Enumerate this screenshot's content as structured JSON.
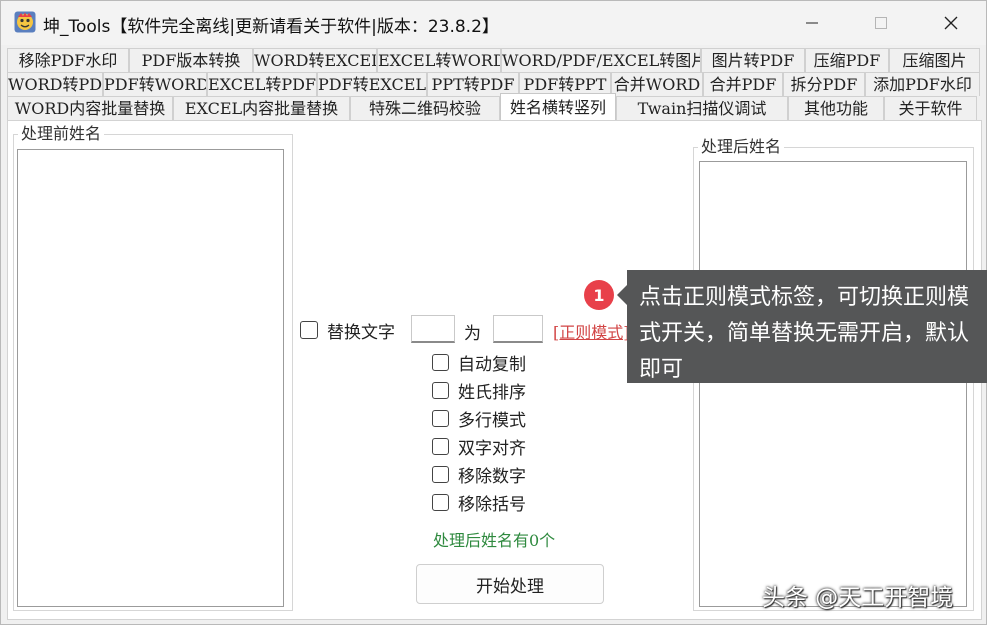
{
  "window": {
    "title": "坤_Tools【软件完全离线|更新请看关于软件|版本：23.8.2】",
    "icon": "app-logo-icon"
  },
  "tab_rows": [
    [
      "移除PDF水印",
      "PDF版本转换",
      "WORD转EXCEL",
      "EXCEL转WORD",
      "WORD/PDF/EXCEL转图片",
      "图片转PDF",
      "压缩PDF",
      "压缩图片"
    ],
    [
      "WORD转PDF",
      "PDF转WORD",
      "EXCEL转PDF",
      "PDF转EXCEL",
      "PPT转PDF",
      "PDF转PPT",
      "合并WORD",
      "合并PDF",
      "拆分PDF",
      "添加PDF水印"
    ],
    [
      "WORD内容批量替换",
      "EXCEL内容批量替换",
      "特殊二维码校验",
      "姓名横转竖列",
      "Twain扫描仪调试",
      "其他功能",
      "关于软件"
    ]
  ],
  "active_tab": "姓名横转竖列",
  "left_group": {
    "label": "处理前姓名"
  },
  "right_group": {
    "label": "处理后姓名"
  },
  "replace": {
    "label": "替换文字",
    "to_label": "为",
    "from_value": "",
    "to_value": "",
    "regex_link": "[正则模式]"
  },
  "options": [
    "自动复制",
    "姓氏排序",
    "多行模式",
    "双字对齐",
    "移除数字",
    "移除括号"
  ],
  "status": "处理后姓名有0个",
  "start_button": "开始处理",
  "tooltip": {
    "badge": "1",
    "text": "点击正则模式标签，可切换正则模式开关，简单替换无需开启，默认即可"
  },
  "watermark": "头条 @天工开智境",
  "colors": {
    "link": "#d24545",
    "status": "#2f8a3f",
    "tooltip_bg": "#555657",
    "badge": "#e8404a"
  }
}
